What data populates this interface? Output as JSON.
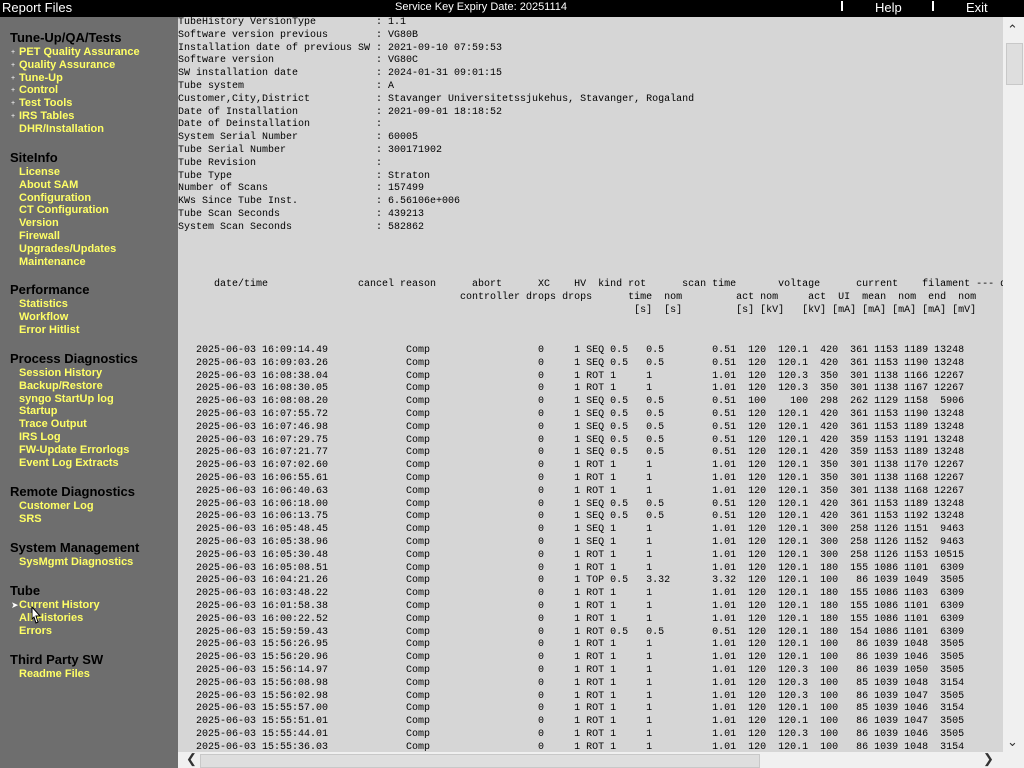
{
  "topbar": {
    "title": "Report Files",
    "service_key": "Service Key Expiry Date:  20251114",
    "help": "Help",
    "exit": "Exit"
  },
  "sidebar": {
    "sections": [
      {
        "title": "Tune-Up/QA/Tests",
        "items": [
          "PET Quality Assurance",
          "Quality Assurance",
          "Tune-Up",
          "Control",
          "Test Tools",
          "IRS Tables",
          "DHR/Installation"
        ]
      },
      {
        "title": "SiteInfo",
        "items": [
          "License",
          "About SAM",
          "Configuration",
          "CT Configuration",
          "Version",
          "Firewall",
          "Upgrades/Updates",
          "Maintenance"
        ]
      },
      {
        "title": "Performance",
        "items": [
          "Statistics",
          "Workflow",
          "Error Hitlist"
        ]
      },
      {
        "title": "Process Diagnostics",
        "items": [
          "Session History",
          "Backup/Restore",
          "syngo StartUp log",
          "Startup",
          "Trace Output",
          "IRS Log",
          "FW-Update Errorlogs",
          "Event Log Extracts"
        ]
      },
      {
        "title": "Remote Diagnostics",
        "items": [
          "Customer Log",
          "SRS"
        ]
      },
      {
        "title": "System Management",
        "items": [
          "SysMgmt Diagnostics"
        ]
      },
      {
        "title": "Tube",
        "items": [
          "Current History",
          "All Histories",
          "Errors"
        ]
      },
      {
        "title": "Third Party SW",
        "items": [
          "Readme Files"
        ]
      }
    ]
  },
  "info_lines": [
    "TubeHistory VersionType          : 1.1",
    "Software version previous        : VG80B",
    "Installation date of previous SW : 2021-09-10 07:59:53",
    "Software version                 : VG80C",
    "SW installation date             : 2024-01-31 09:01:15",
    "Tube system                      : A",
    "Customer,City,District           : Stavanger Universitetssjukehus, Stavanger, Rogaland",
    "Date of Installation             : 2021-09-01 18:18:52",
    "Date of Deinstallation           :",
    "System Serial Number             : 60005",
    "Tube Serial Number               : 300171902",
    "Tube Revision                    :",
    "Tube Type                        : Straton",
    "Number of Scans                  : 157499",
    "KWs Since Tube Inst.             : 6.56106e+006",
    "Tube Scan Seconds                : 439213",
    "System Scan Seconds              : 582862"
  ],
  "header_lines": [
    "      date/time               cancel reason      abort      XC    HV  kind rot      scan time       voltage      current    filament --- do",
    "                                               controller drops drops      time  nom         act nom     act  UI  mean  nom  end  nom",
    "                                                                            [s]  [s]         [s] [kV]   [kV] [mA] [mA] [mA] [mA] [mV]"
  ],
  "rows": [
    "   2025-06-03 16:09:14.49             Comp                  0     1 SEQ 0.5   0.5        0.51  120  120.1  420  361 1153 1189 13248",
    "   2025-06-03 16:09:03.26             Comp                  0     1 SEQ 0.5   0.5        0.51  120  120.1  420  361 1153 1190 13248",
    "   2025-06-03 16:08:38.04             Comp                  0     1 ROT 1     1          1.01  120  120.3  350  301 1138 1166 12267",
    "   2025-06-03 16:08:30.05             Comp                  0     1 ROT 1     1          1.01  120  120.3  350  301 1138 1167 12267",
    "   2025-06-03 16:08:08.20             Comp                  0     1 SEQ 0.5   0.5        0.51  100    100  298  262 1129 1158  5906",
    "   2025-06-03 16:07:55.72             Comp                  0     1 SEQ 0.5   0.5        0.51  120  120.1  420  361 1153 1190 13248",
    "   2025-06-03 16:07:46.98             Comp                  0     1 SEQ 0.5   0.5        0.51  120  120.1  420  361 1153 1189 13248",
    "   2025-06-03 16:07:29.75             Comp                  0     1 SEQ 0.5   0.5        0.51  120  120.1  420  359 1153 1191 13248",
    "   2025-06-03 16:07:21.77             Comp                  0     1 SEQ 0.5   0.5        0.51  120  120.1  420  359 1153 1189 13248",
    "   2025-06-03 16:07:02.60             Comp                  0     1 ROT 1     1          1.01  120  120.1  350  301 1138 1170 12267",
    "   2025-06-03 16:06:55.61             Comp                  0     1 ROT 1     1          1.01  120  120.1  350  301 1138 1168 12267",
    "   2025-06-03 16:06:40.63             Comp                  0     1 ROT 1     1          1.01  120  120.1  350  301 1138 1168 12267",
    "   2025-06-03 16:06:18.00             Comp                  0     1 SEQ 0.5   0.5        0.51  120  120.1  420  361 1153 1189 13248",
    "   2025-06-03 16:06:13.75             Comp                  0     1 SEQ 0.5   0.5        0.51  120  120.1  420  361 1153 1192 13248",
    "   2025-06-03 16:05:48.45             Comp                  0     1 SEQ 1     1          1.01  120  120.1  300  258 1126 1151  9463",
    "   2025-06-03 16:05:38.96             Comp                  0     1 SEQ 1     1          1.01  120  120.1  300  258 1126 1152  9463",
    "   2025-06-03 16:05:30.48             Comp                  0     1 ROT 1     1          1.01  120  120.1  300  258 1126 1153 10515",
    "   2025-06-03 16:05:08.51             Comp                  0     1 ROT 1     1          1.01  120  120.1  180  155 1086 1101  6309",
    "   2025-06-03 16:04:21.26             Comp                  0     1 TOP 0.5   3.32       3.32  120  120.1  100   86 1039 1049  3505",
    "   2025-06-03 16:03:48.22             Comp                  0     1 ROT 1     1          1.01  120  120.1  180  155 1086 1103  6309",
    "   2025-06-03 16:01:58.38             Comp                  0     1 ROT 1     1          1.01  120  120.1  180  155 1086 1101  6309",
    "   2025-06-03 16:00:22.52             Comp                  0     1 ROT 1     1          1.01  120  120.1  180  155 1086 1101  6309",
    "   2025-06-03 15:59:59.43             Comp                  0     1 ROT 0.5   0.5        0.51  120  120.1  180  154 1086 1101  6309",
    "   2025-06-03 15:56:26.95             Comp                  0     1 ROT 1     1          1.01  120  120.1  100   86 1039 1048  3505",
    "   2025-06-03 15:56:20.96             Comp                  0     1 ROT 1     1          1.01  120  120.1  100   86 1039 1046  3505",
    "   2025-06-03 15:56:14.97             Comp                  0     1 ROT 1     1          1.01  120  120.3  100   86 1039 1050  3505",
    "   2025-06-03 15:56:08.98             Comp                  0     1 ROT 1     1          1.01  120  120.3  100   85 1039 1048  3154",
    "   2025-06-03 15:56:02.98             Comp                  0     1 ROT 1     1          1.01  120  120.3  100   86 1039 1047  3505",
    "   2025-06-03 15:55:57.00             Comp                  0     1 ROT 1     1          1.01  120  120.1  100   85 1039 1046  3154",
    "   2025-06-03 15:55:51.01             Comp                  0     1 ROT 1     1          1.01  120  120.1  100   86 1039 1047  3505",
    "   2025-06-03 15:55:44.01             Comp                  0     1 ROT 1     1          1.01  120  120.3  100   86 1039 1046  3505",
    "   2025-06-03 15:55:36.03             Comp                  0     1 ROT 1     1          1.01  120  120.1  100   86 1039 1048  3154"
  ]
}
